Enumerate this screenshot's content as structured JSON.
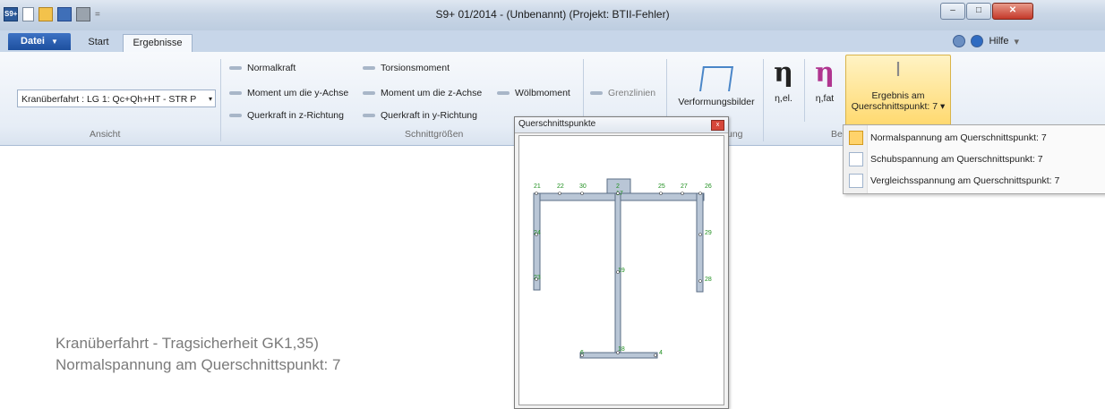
{
  "window": {
    "title": "S9+  01/2014 - (Unbenannt) (Projekt: BTII-Fehler)",
    "app_icon_text": "S9+",
    "qat_separator": "=",
    "controls": [
      "minimize",
      "maximize",
      "close"
    ]
  },
  "tabs": {
    "file": "Datei",
    "file_arrow": "▼",
    "start": "Start",
    "results": "Ergebnisse",
    "help": "Hilfe",
    "help_arrow": "▾"
  },
  "ribbon": {
    "ansicht": {
      "dropdown_value": "Kranüberfahrt : LG 1: Qc+Qh+HT - STR P",
      "dropdown_arrow": "▾",
      "label": "Ansicht"
    },
    "schnittgroessen": {
      "col1": [
        "Normalkraft",
        "Moment um die y-Achse",
        "Querkraft in z-Richtung"
      ],
      "col2": [
        "Torsionsmoment",
        "Moment um die z-Achse",
        "Querkraft in y-Richtung"
      ],
      "col3": [
        "Wölbmoment"
      ],
      "label": "Schnittgrößen"
    },
    "grenzlinien": "Grenzlinien",
    "verformung": {
      "button": "Verformungsbilder",
      "label_fragment": "ung"
    },
    "eta_el": {
      "glyph": "η",
      "label": "η,el."
    },
    "eta_fat": {
      "glyph": "η",
      "label": "η,fat"
    },
    "be_label": "Be",
    "ergebnis": {
      "line1": "Ergebnis am",
      "line2": "Querschnittspunkt: 7",
      "arrow": "▾",
      "icon": "Ⅰ"
    }
  },
  "popup_menu": {
    "items": [
      "Normalspannung am Querschnittspunkt: 7",
      "Schubspannung am Querschnittspunkt: 7",
      "Vergleichsspannung am Querschnittspunkt: 7"
    ],
    "selected_index": 0
  },
  "querschnitt_window": {
    "title": "Querschnittspunkte",
    "close_glyph": "x",
    "points": {
      "p21": "21",
      "p22": "22",
      "p30": "30",
      "p2": "2",
      "p25": "25",
      "p27": "27",
      "p26": "26",
      "p17": "17",
      "p24": "24",
      "p29": "29",
      "p19": "19",
      "p23": "23",
      "p28": "28",
      "p18": "18",
      "p6": "6",
      "p4": "4"
    }
  },
  "results_text": {
    "line1": "Kranüberfahrt - Tragsicherheit GK1,35)",
    "line2": "Normalspannung am Querschnittspunkt: 7"
  }
}
